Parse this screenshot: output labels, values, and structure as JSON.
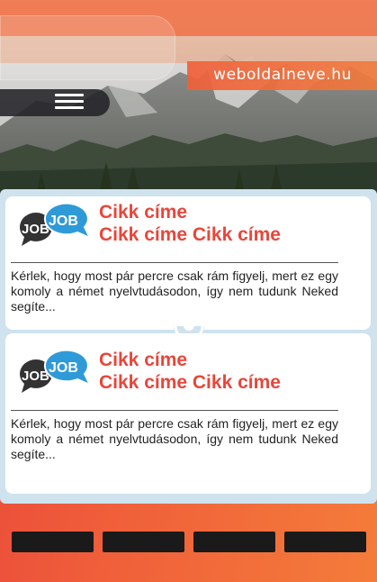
{
  "header": {
    "domain": "weboldalneve.hu"
  },
  "articles": [
    {
      "title_line1": "Cikk címe",
      "title_line2": "Cikk címe Cikk címe",
      "excerpt": "Kérlek, hogy most pár percre csak rám figyelj, mert ez egy komoly  a német nyelvtudásodon, így nem tudunk Neked segíte...",
      "icon": {
        "back_label": "JOB",
        "front_label": "JOB",
        "back_color": "#333333",
        "front_color": "#2f9ad8"
      }
    },
    {
      "title_line1": "Cikk címe",
      "title_line2": "Cikk címe Cikk címe",
      "excerpt": "Kérlek, hogy most pár percre csak rám figyelj, mert ez egy komoly  a német nyelvtudásodon, így nem tudunk Neked segíte...",
      "icon": {
        "back_label": "JOB",
        "front_label": "JOB",
        "back_color": "#333333",
        "front_color": "#2f9ad8"
      }
    }
  ],
  "footer": {
    "buttons": [
      "",
      "",
      "",
      ""
    ]
  },
  "colors": {
    "accent": "#e8463b",
    "panel": "#cfe3ee",
    "job_blue": "#2f9ad8"
  }
}
